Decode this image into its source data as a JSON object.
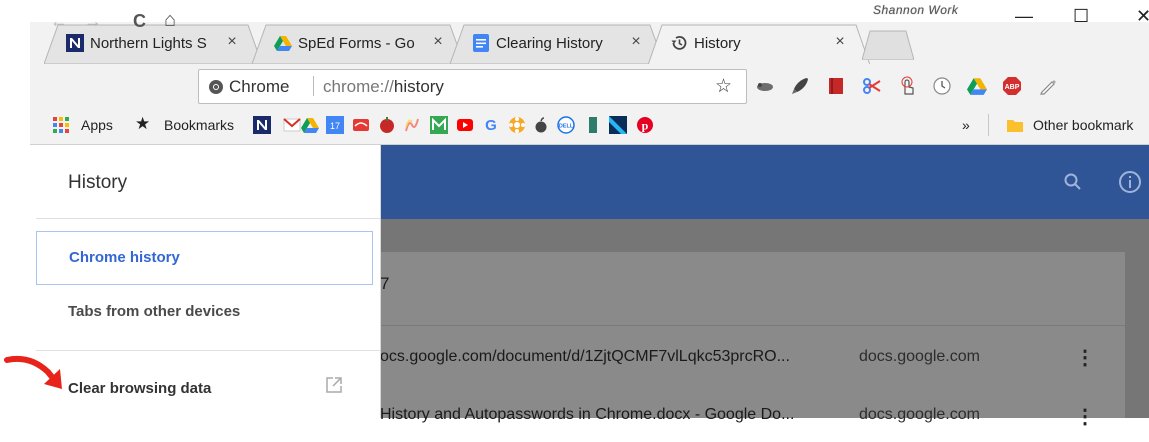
{
  "window": {
    "owner": "Shannon Work",
    "minimize": "—",
    "maximize": "☐",
    "close": "✕"
  },
  "tabs": [
    {
      "title": "Northern Lights S",
      "close": "×",
      "icon": "northern-lights-icon"
    },
    {
      "title": "SpEd Forms - Go",
      "close": "×",
      "icon": "google-drive-icon"
    },
    {
      "title": "Clearing History",
      "close": "×",
      "icon": "google-docs-icon"
    },
    {
      "title": "History",
      "close": "×",
      "icon": "history-clock-icon"
    }
  ],
  "toolbar": {
    "back": "←",
    "forward": "→",
    "reload": "C",
    "home": "⌂",
    "site_label": "Chrome",
    "url_scheme": "chrome://",
    "url_path": "history",
    "star": "☆"
  },
  "bookmarks": {
    "apps_label": "Apps",
    "bookmarks_label": "Bookmarks",
    "overflow": "»",
    "other_label": "Other bookmark",
    "calendar_day": "17"
  },
  "drawer": {
    "title": "History",
    "items": [
      {
        "label": "Chrome history"
      },
      {
        "label": "Tabs from other devices"
      },
      {
        "label": "Clear browsing data"
      }
    ]
  },
  "page": {
    "partial_date": "7",
    "rows": [
      {
        "title": "ocs.google.com/document/d/1ZjtQCMF7vlLqkc53prcRO...",
        "domain": "docs.google.com",
        "menu": "⋮"
      },
      {
        "title": "History and Autopasswords in Chrome.docx - Google Do...",
        "domain": "docs.google.com",
        "menu": "⋮"
      }
    ]
  },
  "colors": {
    "header_blue": "#2f5597",
    "link_blue": "#3367d6",
    "overlay_gray": "#767676",
    "annotation_red": "#e8231b"
  }
}
